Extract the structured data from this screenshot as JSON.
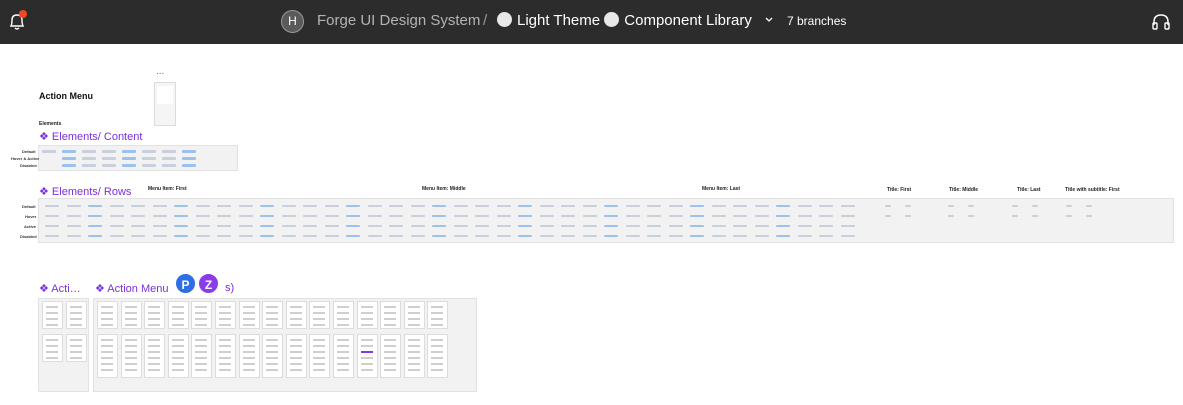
{
  "topbar": {
    "avatar_initial": "H",
    "project": "Forge UI Design System",
    "separator": "/",
    "file_parts": [
      "Light Theme",
      "Component Library"
    ],
    "branches": "7 branches"
  },
  "canvas": {
    "title": "Action Menu",
    "dots": "...",
    "elements_label": "Elements",
    "content_section": "❖ Elements/ Content",
    "content_rows": [
      "Default",
      "Hover & Active",
      "Disabled"
    ],
    "rows_section": "❖ Elements/ Rows",
    "rows_groups": [
      "Menu Item: First",
      "Menu Item: Middle",
      "Menu Item: Last",
      "Title: First",
      "Title: Middle",
      "Title: Last",
      "Title with subtitle: First"
    ],
    "rows_states": [
      "Default",
      "Hover",
      "Active",
      "Disabled"
    ],
    "section_a": "❖ Acti…",
    "section_b": "❖ Action Menu",
    "section_b_tail": "s)",
    "collaborators": [
      "P",
      "Z"
    ]
  },
  "colors": {
    "topbar": "#2c2c2c",
    "accent_purple": "#7b2fe0",
    "avatar_p": "#2e6fe4",
    "avatar_z": "#8a3ce6",
    "notification": "#f24822"
  }
}
